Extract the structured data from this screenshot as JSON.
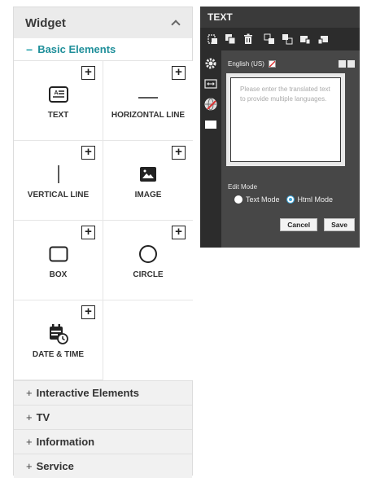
{
  "widget": {
    "title": "Widget",
    "open_category": {
      "sign": "−",
      "label": "Basic Elements"
    },
    "elements": [
      {
        "label": "TEXT",
        "icon": "text-icon",
        "plus": "+"
      },
      {
        "label": "HORIZONTAL LINE",
        "icon": "horizontal-line-icon",
        "plus": "+"
      },
      {
        "label": "VERTICAL LINE",
        "icon": "vertical-line-icon",
        "plus": "+"
      },
      {
        "label": "IMAGE",
        "icon": "image-icon",
        "plus": "+"
      },
      {
        "label": "BOX",
        "icon": "box-icon",
        "plus": "+"
      },
      {
        "label": "CIRCLE",
        "icon": "circle-icon",
        "plus": "+"
      },
      {
        "label": "DATE & TIME",
        "icon": "date-time-icon",
        "plus": "+"
      }
    ],
    "categories": [
      {
        "sign": "+",
        "label": "Interactive Elements"
      },
      {
        "sign": "+",
        "label": "TV"
      },
      {
        "sign": "+",
        "label": "Information"
      },
      {
        "sign": "+",
        "label": "Service"
      }
    ]
  },
  "text_panel": {
    "title": "TEXT",
    "language": "English (US)",
    "placeholder": "Please enter the translated text to provide multiple languages.",
    "edit_mode_label": "Edit Mode",
    "mode_text": "Text Mode",
    "mode_html": "Html Mode",
    "selected_mode": "Html Mode",
    "cancel_label": "Cancel",
    "save_label": "Save"
  },
  "colors": {
    "accent": "#1f8f9a",
    "panel_dark": "#474747",
    "toolbar_dark": "#2c2c2c",
    "radio_selected": "#3ea6d9"
  }
}
